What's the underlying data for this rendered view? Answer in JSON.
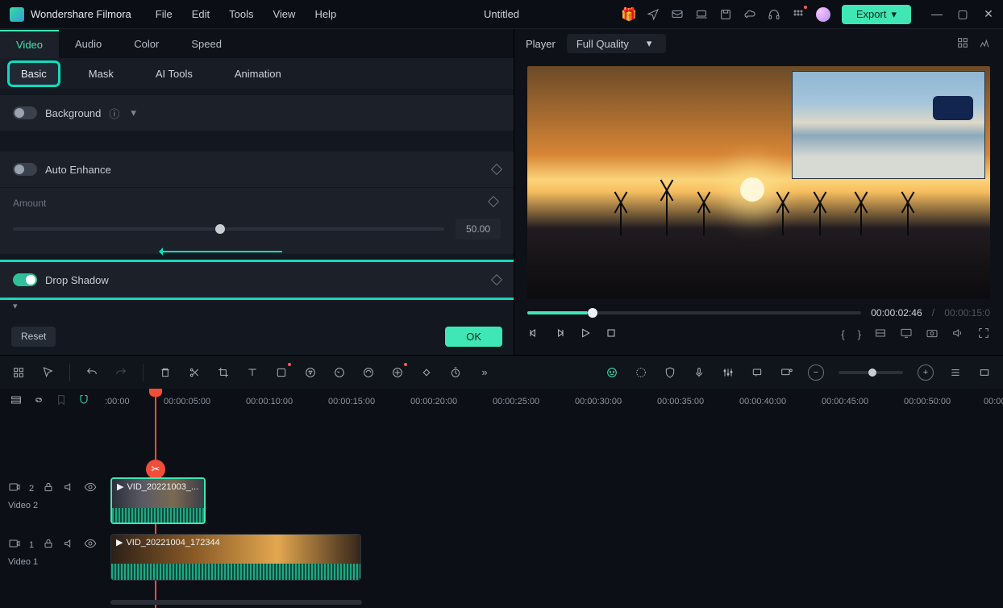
{
  "app_name": "Wondershare Filmora",
  "project_title": "Untitled",
  "menu": {
    "file": "File",
    "edit": "Edit",
    "tools": "Tools",
    "view": "View",
    "help": "Help"
  },
  "export_label": "Export",
  "top_tabs": {
    "video": "Video",
    "audio": "Audio",
    "color": "Color",
    "speed": "Speed"
  },
  "sub_tabs": {
    "basic": "Basic",
    "mask": "Mask",
    "ai_tools": "AI Tools",
    "animation": "Animation"
  },
  "props": {
    "background": "Background",
    "auto_enhance": "Auto Enhance",
    "amount": "Amount",
    "amount_value": "50.00",
    "drop_shadow": "Drop Shadow"
  },
  "footer": {
    "reset": "Reset",
    "ok": "OK"
  },
  "player": {
    "label": "Player",
    "quality": "Full Quality",
    "current": "00:00:02:46",
    "sep": "/",
    "total": "00:00:15:0"
  },
  "ruler": {
    "marks": [
      ":00:00",
      "00:00:05:00",
      "00:00:10:00",
      "00:00:15:00",
      "00:00:20:00",
      "00:00:25:00",
      "00:00:30:00",
      "00:00:35:00",
      "00:00:40:00",
      "00:00:45:00",
      "00:00:50:00",
      "00:00"
    ]
  },
  "tracks": {
    "v2": {
      "badge": "2",
      "name": "Video 2",
      "clip_label": "VID_20221003_..."
    },
    "v1": {
      "badge": "1",
      "name": "Video 1",
      "clip_label": "VID_20221004_172344"
    }
  }
}
